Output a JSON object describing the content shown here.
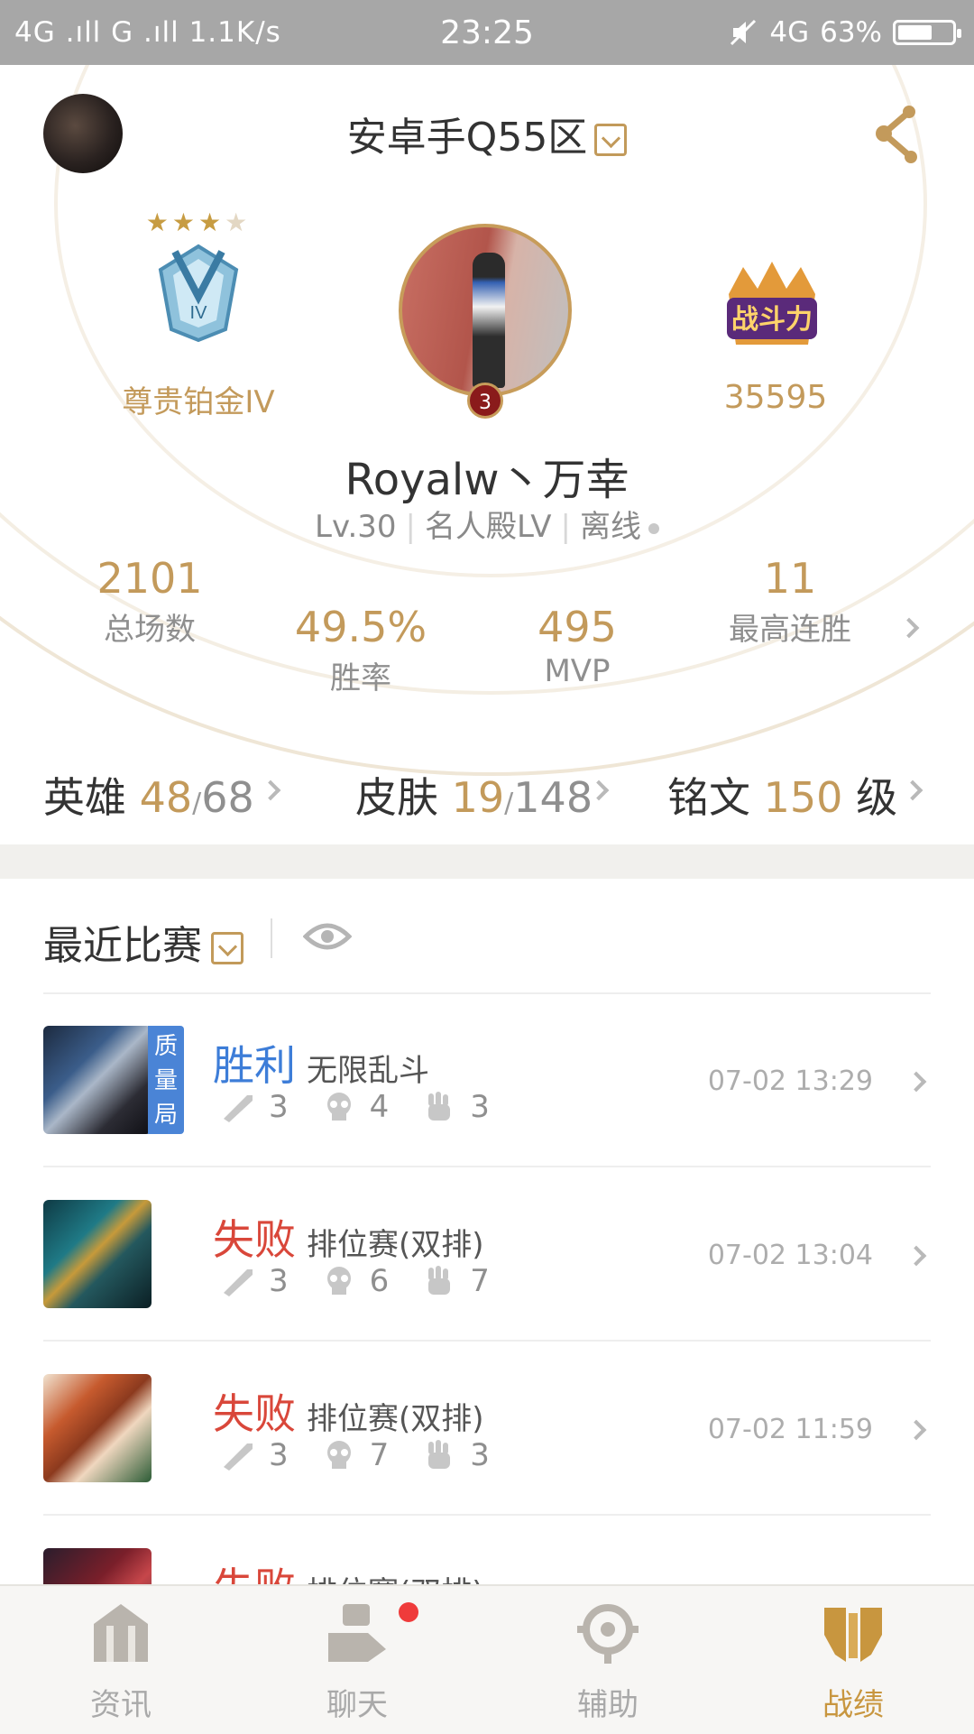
{
  "status_bar": {
    "left": "4G .ıll G .ıll 1.1K/s",
    "time": "23:25",
    "network": "4G",
    "battery": "63%",
    "battery_level": 0.63
  },
  "header": {
    "server": "安卓手Q55区",
    "share_icon": "share-icon"
  },
  "profile": {
    "rank_stars": "★★★",
    "rank_star_filled": 3,
    "rank_star_total": 4,
    "rank_label": "尊贵铂金IV",
    "rank_badge_text": "IV",
    "power_badge_text": "战斗力",
    "power_value": "35595",
    "level_badge": "3",
    "username": "Royalw丶万幸",
    "level": "Lv.30",
    "hall": "名人殿LV",
    "status": "离线"
  },
  "stats": {
    "total_games": {
      "value": "2101",
      "label": "总场数"
    },
    "win_rate": {
      "value": "49.5%",
      "label": "胜率"
    },
    "mvp": {
      "value": "495",
      "label": "MVP"
    },
    "max_streak": {
      "value": "11",
      "label": "最高连胜"
    }
  },
  "collections": {
    "heroes": {
      "label": "英雄",
      "owned": "48",
      "sep": "/",
      "total": "68"
    },
    "skins": {
      "label": "皮肤",
      "owned": "19",
      "sep": "/",
      "total": "148"
    },
    "runes": {
      "label": "铭文",
      "value": "150",
      "unit": "级"
    }
  },
  "recent": {
    "title": "最近比赛",
    "matches": [
      {
        "result": "胜利",
        "mode": "无限乱斗",
        "tag": "质量局",
        "kills": "3",
        "deaths": "4",
        "assists": "3",
        "time": "07-02 13:29"
      },
      {
        "result": "失败",
        "mode": "排位赛(双排)",
        "kills": "3",
        "deaths": "6",
        "assists": "7",
        "time": "07-02 13:04"
      },
      {
        "result": "失败",
        "mode": "排位赛(双排)",
        "kills": "3",
        "deaths": "7",
        "assists": "3",
        "time": "07-02 11:59"
      },
      {
        "result": "失败",
        "mode": "排位赛(双排)"
      }
    ]
  },
  "tabbar": {
    "items": [
      {
        "label": "资讯",
        "icon": "news-icon"
      },
      {
        "label": "聊天",
        "icon": "chat-icon"
      },
      {
        "label": "辅助",
        "icon": "assist-icon"
      },
      {
        "label": "战绩",
        "icon": "record-icon"
      }
    ],
    "active": "战绩"
  },
  "colors": {
    "gold": "#c39a5b",
    "win": "#3d7dd8",
    "lose": "#d9473a",
    "tag_bg": "#4a84d6"
  }
}
